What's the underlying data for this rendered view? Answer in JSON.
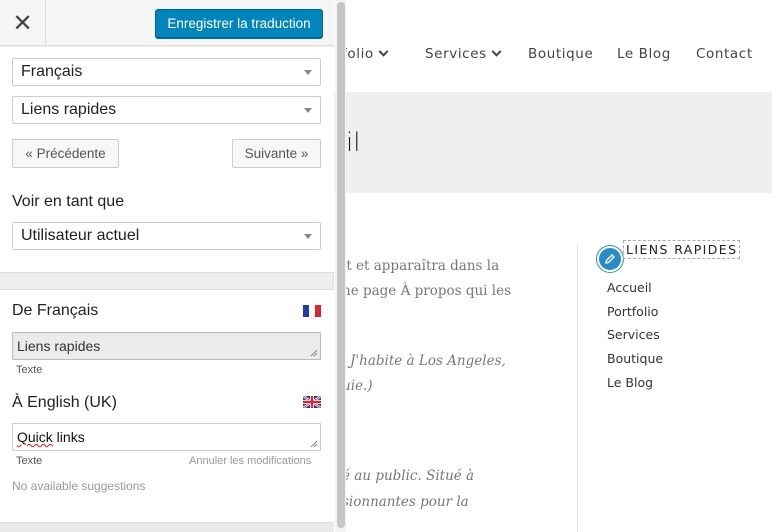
{
  "site": {
    "nav": [
      "folio",
      "Services",
      "Boutique",
      "Le Blog",
      "Contact"
    ],
    "hero_title_fragment": "il",
    "body_lines": [
      "it et apparaîtra dans la",
      "ne page À propos qui les",
      "J'habite à Los Angeles,",
      "uie.)",
      "é au public. Situé à",
      "sionnantes pour la"
    ],
    "widget": {
      "title": "LIENS RAPIDES",
      "links": [
        "Accueil",
        "Portfolio",
        "Services",
        "Boutique",
        "Le Blog"
      ]
    }
  },
  "panel": {
    "close_icon": "close-icon",
    "save_label": "Enregistrer la traduction",
    "language_select": "Français",
    "string_select": "Liens rapides",
    "prev_label": "« Précédente",
    "next_label": "Suivante »",
    "view_as_label": "Voir en tant que",
    "view_as_select": "Utilisateur actuel",
    "source": {
      "label": "De Français",
      "flag": "flag-fr",
      "value": "Liens rapides",
      "type_label": "Texte"
    },
    "target": {
      "label": "À English (UK)",
      "flag": "flag-uk",
      "value_word1": "Quick",
      "value_rest": " links",
      "type_label": "Texte",
      "discard_label": "Annuler les modifications"
    },
    "suggestions_text": "No available suggestions"
  },
  "colors": {
    "accent": "#0085ba",
    "edit_badge": "#2a8cc6"
  }
}
